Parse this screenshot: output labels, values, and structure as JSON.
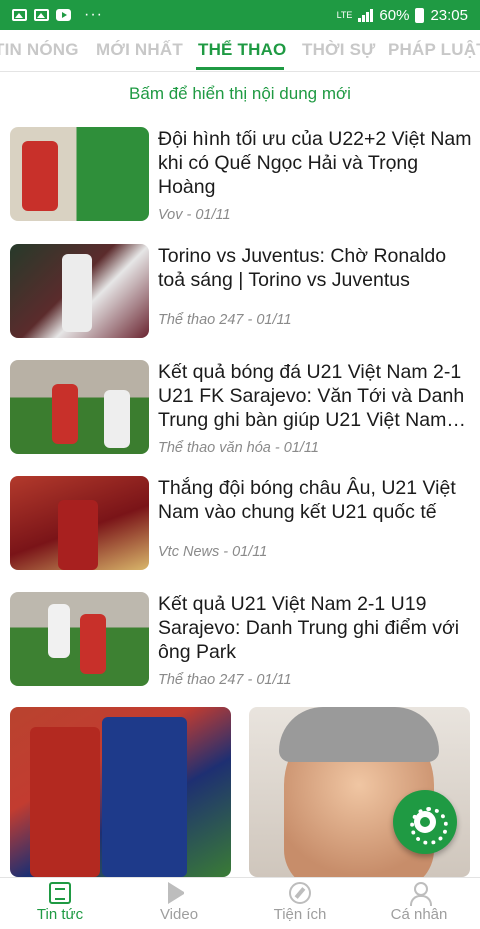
{
  "status_bar": {
    "lte_label": "LTE",
    "battery": "60%",
    "time": "23:05",
    "more": "···"
  },
  "tabs": [
    {
      "label": "TIN NÓNG",
      "active": false
    },
    {
      "label": "MỚI NHẤT",
      "active": false
    },
    {
      "label": "THỂ THAO",
      "active": true
    },
    {
      "label": "THỜI SỰ",
      "active": false
    },
    {
      "label": "PHÁP LUẬT",
      "active": false
    }
  ],
  "refresh_text": "Bấm để hiển thị nội dung mới",
  "articles": [
    {
      "title": "Đội hình tối ưu của U22+2 Việt Nam khi có Quế Ngọc Hải và Trọng Hoàng",
      "meta": "Vov - 01/11"
    },
    {
      "title": "Torino vs Juventus: Chờ Ronaldo toả sáng | Torino vs Juventus",
      "meta": "Thể thao 247 - 01/11"
    },
    {
      "title": "Kết quả bóng đá U21 Việt Nam 2-1 U21 FK Sarajevo: Văn Tới và Danh Trung ghi bàn giúp U21 Việt Nam…",
      "meta": "Thể thao văn hóa - 01/11"
    },
    {
      "title": "Thắng đội bóng châu Âu, U21 Việt Nam vào chung kết U21 quốc tế",
      "meta": "Vtc News - 01/11"
    },
    {
      "title": "Kết quả U21 Việt Nam 2-1 U19 Sarajevo: Danh Trung ghi điểm với ông Park",
      "meta": "Thể thao 247 - 01/11"
    }
  ],
  "bottom_nav": [
    {
      "label": "Tin tức",
      "icon": "news-icon",
      "active": true
    },
    {
      "label": "Video",
      "icon": "video-icon",
      "active": false
    },
    {
      "label": "Tiện ích",
      "icon": "compass-icon",
      "active": false
    },
    {
      "label": "Cá nhân",
      "icon": "user-icon",
      "active": false
    }
  ],
  "colors": {
    "accent": "#1f9a43",
    "status_bar": "#1f9a43",
    "meta": "#8a8a8a",
    "tab_inactive": "#c8c8c8"
  }
}
